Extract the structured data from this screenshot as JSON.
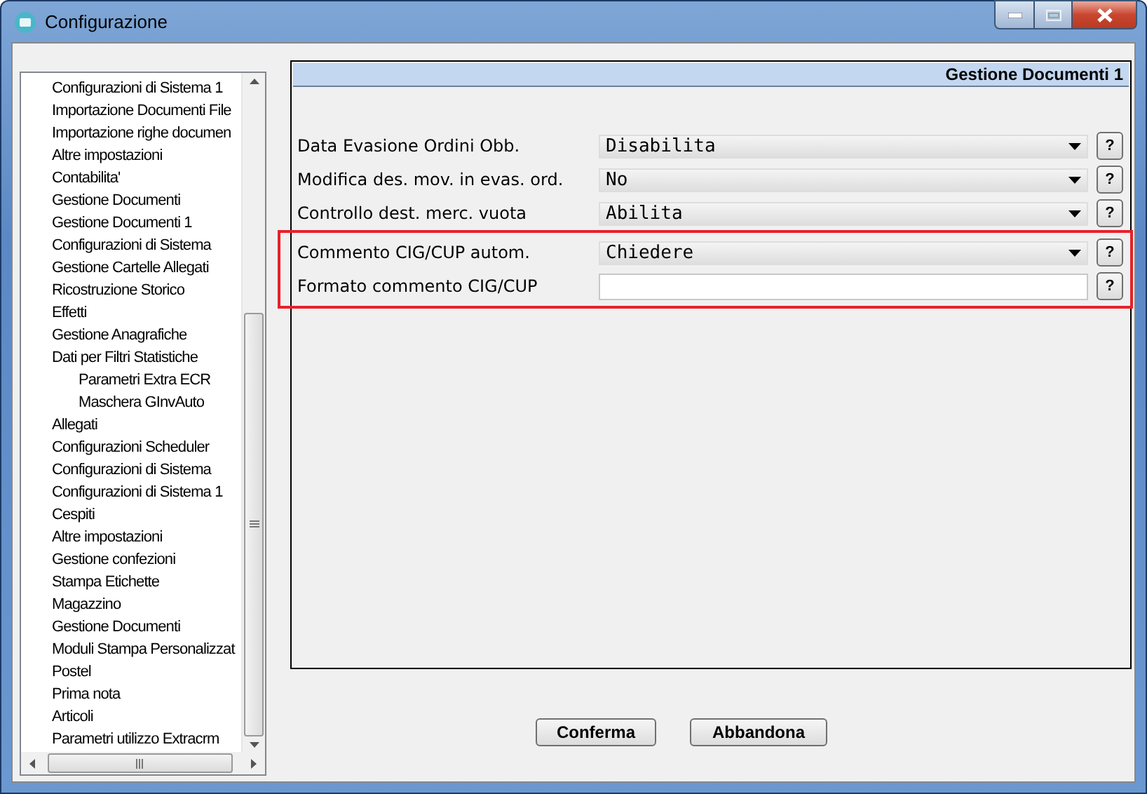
{
  "window": {
    "title": "Configurazione"
  },
  "sidebar": {
    "items": [
      {
        "label": "Configurazioni di Sistema 1"
      },
      {
        "label": "Importazione Documenti File"
      },
      {
        "label": "Importazione righe documen"
      },
      {
        "label": "Altre impostazioni"
      },
      {
        "label": "Contabilita'"
      },
      {
        "label": "Gestione Documenti"
      },
      {
        "label": "Gestione Documenti 1"
      },
      {
        "label": "Configurazioni di Sistema"
      },
      {
        "label": "Gestione Cartelle Allegati"
      },
      {
        "label": "Ricostruzione Storico"
      },
      {
        "label": "Effetti"
      },
      {
        "label": "Gestione Anagrafiche"
      },
      {
        "label": "Dati per Filtri Statistiche",
        "children": [
          {
            "label": "Parametri Extra ECR"
          },
          {
            "label": "Maschera GInvAuto"
          }
        ]
      },
      {
        "label": "Allegati"
      },
      {
        "label": "Configurazioni Scheduler"
      },
      {
        "label": "Configurazioni di Sistema"
      },
      {
        "label": "Configurazioni di Sistema 1"
      },
      {
        "label": "Cespiti"
      },
      {
        "label": "Altre impostazioni"
      },
      {
        "label": "Gestione confezioni"
      },
      {
        "label": "Stampa Etichette"
      },
      {
        "label": "Magazzino"
      },
      {
        "label": "Gestione Documenti"
      },
      {
        "label": "Moduli Stampa Personalizzat"
      },
      {
        "label": "Postel"
      },
      {
        "label": "Prima nota"
      },
      {
        "label": "Articoli"
      },
      {
        "label": "Parametri utilizzo Extracrm"
      }
    ]
  },
  "panel": {
    "title": "Gestione Documenti 1",
    "rows": [
      {
        "label": "Data Evasione Ordini Obb.",
        "kind": "select",
        "value": "Disabilita",
        "help": "?",
        "highlighted": false
      },
      {
        "label": "Modifica des. mov. in evas. ord.",
        "kind": "select",
        "value": "No",
        "help": "?",
        "highlighted": false
      },
      {
        "label": "Controllo dest. merc. vuota",
        "kind": "select",
        "value": "Abilita",
        "help": "?",
        "highlighted": false
      },
      {
        "label": "Commento CIG/CUP autom.",
        "kind": "select",
        "value": "Chiedere",
        "help": "?",
        "highlighted": true
      },
      {
        "label": "Formato commento CIG/CUP",
        "kind": "text",
        "help": "?",
        "highlighted": true
      }
    ]
  },
  "buttons": [
    {
      "label": "Conferma"
    },
    {
      "label": "Abbandona"
    }
  ]
}
